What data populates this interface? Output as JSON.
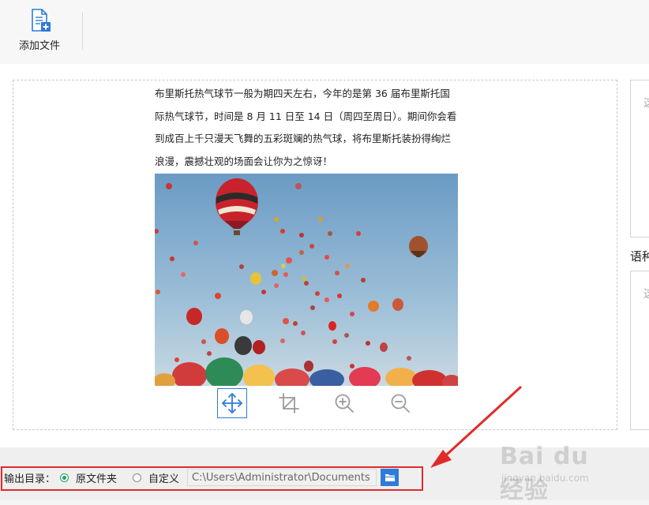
{
  "toolbar": {
    "add_file_label": "添加文件"
  },
  "document": {
    "lines": [
      "布里斯托热气球节一般为期四天左右，今年的是第 36 届布里斯托国",
      "际热气球节，时间是 8 月 11 日至 14 日（周四至周日）。期间你会看",
      "到成百上千只漫天飞舞的五彩斑斓的热气球，将布里斯托装扮得绚烂",
      "浪漫，震撼壮观的场面会让你为之惊讶！"
    ]
  },
  "image_tools": [
    "move-icon",
    "crop-icon",
    "zoom-in-icon",
    "zoom-out-icon"
  ],
  "side": {
    "frag1": "这",
    "label": "语种",
    "frag2": "这"
  },
  "output": {
    "label": "输出目录：",
    "option_original": "原文件夹",
    "option_custom": "自定义",
    "selected": "原文件夹",
    "path": "C:\\Users\\Administrator\\Documents"
  },
  "colors": {
    "accent": "#2f7bd9",
    "radio_checked": "#1aa260",
    "annotation": "#e02b2b"
  },
  "watermark": {
    "brand": "Bai du 经验",
    "sub": "jingyan.baidu.com"
  }
}
